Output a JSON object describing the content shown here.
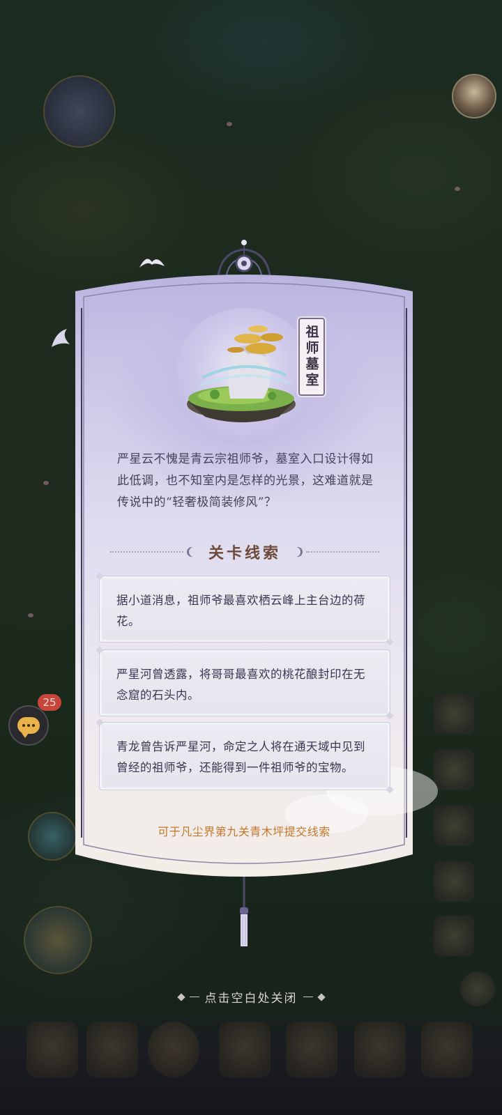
{
  "map": {
    "chat_badge_count": "25"
  },
  "dialog": {
    "location_name": "祖师墓室",
    "description": "严星云不愧是青云宗祖师爷，墓室入口设计得如此低调，也不知室内是怎样的光景，这难道就是传说中的“轻奢极简装修风”？",
    "clues_title": "关卡线索",
    "clues": [
      "据小道消息，祖师爷最喜欢栖云峰上主台边的荷花。",
      "严星河曾透露，将哥哥最喜欢的桃花酿封印在无念窟的石头内。",
      "青龙曾告诉严星河，命定之人将在通天域中见到曾经的祖师爷，还能得到一件祖师爷的宝物。"
    ],
    "submit_hint": "可于凡尘界第九关青木坪提交线索"
  },
  "close_hint": "点击空白处关闭",
  "colors": {
    "accent_orange": "#c4762a",
    "clue_title": "#6e4a3a",
    "badge_red": "#c8453c"
  }
}
